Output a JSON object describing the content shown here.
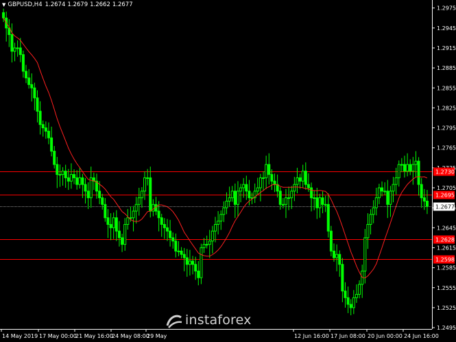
{
  "header": {
    "symbol": "GBPUSD,H4",
    "open": "1.2674",
    "high": "1.2679",
    "low": "1.2662",
    "close": "1.2677"
  },
  "colors": {
    "background": "#000000",
    "bull_candle": "#00ff00",
    "moving_average": "#ff2020",
    "level_line": "#ff0000",
    "level_tag_bg": "#ff0000",
    "price_axis_line": "#ffffff",
    "current_price_tag_bg": "#ffffff",
    "current_price_line": "#8a8a8a"
  },
  "watermark": {
    "text": "instaforex",
    "logo_icon": "instaforex-logo-icon"
  },
  "price_axis": {
    "ticks": [
      "1.2975",
      "1.2945",
      "1.2915",
      "1.2885",
      "1.2855",
      "1.2825",
      "1.2795",
      "1.2765",
      "1.2735",
      "1.2705",
      "1.2675",
      "1.2645",
      "1.2615",
      "1.2585",
      "1.2555",
      "1.2525",
      "1.2495"
    ]
  },
  "time_axis": {
    "labels": [
      "14 May 2019",
      "17 May 00:00",
      "21 May 16:00",
      "24 May 08:00",
      "29 May",
      "12 Jun 16:00",
      "17 Jun 08:00",
      "20 Jun 00:00",
      "24 Jun 16:00"
    ]
  },
  "current_price": "1.2677",
  "chart_data": {
    "type": "candlestick",
    "symbol": "GBPUSD",
    "timeframe": "H4",
    "ylim": [
      1.2495,
      1.2985
    ],
    "levels": [
      {
        "price": 1.273,
        "label": "1.2730"
      },
      {
        "price": 1.2695,
        "label": "1.2695"
      },
      {
        "price": 1.2628,
        "label": "1.2628"
      },
      {
        "price": 1.2598,
        "label": "1.2598"
      }
    ],
    "current_price": 1.2677,
    "close": [
      1.296,
      1.2945,
      1.2935,
      1.291,
      1.2915,
      1.2915,
      1.2905,
      1.288,
      1.287,
      1.286,
      1.2855,
      1.284,
      1.282,
      1.28,
      1.2795,
      1.279,
      1.278,
      1.276,
      1.274,
      1.2725,
      1.2725,
      1.273,
      1.272,
      1.2715,
      1.2725,
      1.272,
      1.271,
      1.272,
      1.271,
      1.27,
      1.269,
      1.272,
      1.2715,
      1.27,
      1.269,
      1.268,
      1.266,
      1.265,
      1.2645,
      1.266,
      1.264,
      1.263,
      1.262,
      1.265,
      1.266,
      1.266,
      1.267,
      1.268,
      1.269,
      1.27,
      1.272,
      1.272,
      1.267,
      1.268,
      1.267,
      1.266,
      1.265,
      1.2645,
      1.264,
      1.263,
      1.2625,
      1.261,
      1.261,
      1.2605,
      1.26,
      1.259,
      1.2595,
      1.259,
      1.258,
      1.257,
      1.2615,
      1.262,
      1.262,
      1.2625,
      1.264,
      1.265,
      1.2655,
      1.2665,
      1.2675,
      1.2685,
      1.269,
      1.27,
      1.268,
      1.27,
      1.2705,
      1.271,
      1.27,
      1.269,
      1.269,
      1.27,
      1.2705,
      1.272,
      1.272,
      1.274,
      1.2725,
      1.2715,
      1.271,
      1.27,
      1.268,
      1.268,
      1.269,
      1.269,
      1.27,
      1.271,
      1.272,
      1.2715,
      1.273,
      1.271,
      1.2705,
      1.269,
      1.269,
      1.2675,
      1.269,
      1.268,
      1.268,
      1.264,
      1.261,
      1.26,
      1.2605,
      1.259,
      1.255,
      1.254,
      1.253,
      1.2525,
      1.254,
      1.2545,
      1.256,
      1.258,
      1.263,
      1.265,
      1.2665,
      1.2675,
      1.269,
      1.2705,
      1.27,
      1.27,
      1.268,
      1.27,
      1.271,
      1.272,
      1.274,
      1.274,
      1.273,
      1.274,
      1.273,
      1.274,
      1.2745,
      1.271,
      1.269,
      1.2685,
      1.2677
    ]
  }
}
